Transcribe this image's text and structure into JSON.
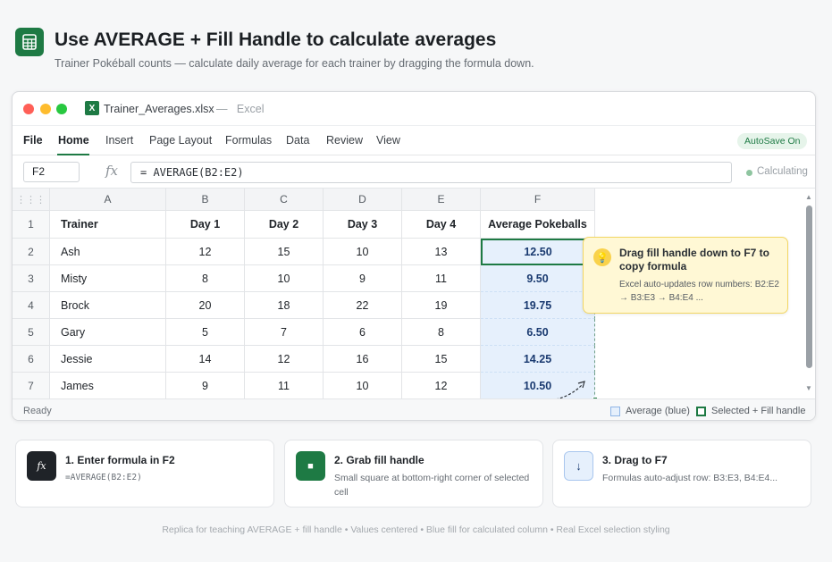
{
  "header": {
    "title": "Use AVERAGE + Fill Handle to calculate averages",
    "subtitle": "Trainer Pokéball counts — calculate daily average for each trainer by dragging the formula down."
  },
  "window": {
    "filename": "Trainer_Averages.xlsx",
    "app_sep": "—",
    "app_name": "Excel",
    "icon_letter": "X"
  },
  "menu": {
    "items": [
      "File",
      "Home",
      "Insert",
      "Page Layout",
      "Formulas",
      "Data",
      "Review",
      "View"
    ],
    "active": "Home",
    "autosave": "AutoSave On"
  },
  "formula_bar": {
    "name_box": "F2",
    "fx": "fx",
    "formula": "= AVERAGE(B2:E2)",
    "status": "Calculating"
  },
  "sheet": {
    "columns": [
      "A",
      "B",
      "C",
      "D",
      "E",
      "F"
    ],
    "headers": [
      "Trainer",
      "Day 1",
      "Day 2",
      "Day 3",
      "Day 4",
      "Average Pokeballs"
    ],
    "rows": [
      {
        "num": "2",
        "cells": [
          "Ash",
          "12",
          "15",
          "10",
          "13",
          "12.50"
        ]
      },
      {
        "num": "3",
        "cells": [
          "Misty",
          "8",
          "10",
          "9",
          "11",
          "9.50"
        ]
      },
      {
        "num": "4",
        "cells": [
          "Brock",
          "20",
          "18",
          "22",
          "19",
          "19.75"
        ]
      },
      {
        "num": "5",
        "cells": [
          "Gary",
          "5",
          "7",
          "6",
          "8",
          "6.50"
        ]
      },
      {
        "num": "6",
        "cells": [
          "Jessie",
          "14",
          "12",
          "16",
          "15",
          "14.25"
        ]
      },
      {
        "num": "7",
        "cells": [
          "James",
          "9",
          "11",
          "10",
          "12",
          "10.50"
        ]
      }
    ],
    "header_row_num": "1"
  },
  "tooltip": {
    "title": "Drag fill handle down to F7 to copy formula",
    "body": "Excel auto-updates row numbers: B2:E2 → B3:E3 → B4:E4 ..."
  },
  "status_bar": {
    "ready": "Ready",
    "legend_blue": "Average (blue)",
    "legend_selected": "Selected + Fill handle"
  },
  "steps": [
    {
      "icon": "fx",
      "title": "1. Enter formula in F2",
      "desc": "=AVERAGE(B2:E2)"
    },
    {
      "icon": "■",
      "title": "2. Grab fill handle",
      "desc": "Small square at bottom-right corner of selected cell"
    },
    {
      "icon": "↓",
      "title": "3. Drag to F7",
      "desc": "Formulas auto-adjust row: B3:E3, B4:E4..."
    }
  ],
  "footer": "Replica for teaching AVERAGE + fill handle • Values centered • Blue fill for calculated column • Real Excel selection styling",
  "colors": {
    "excel_green": "#1e7a44",
    "calc_fill": "#e6f0fc",
    "tooltip_bg": "#fff8d5"
  }
}
